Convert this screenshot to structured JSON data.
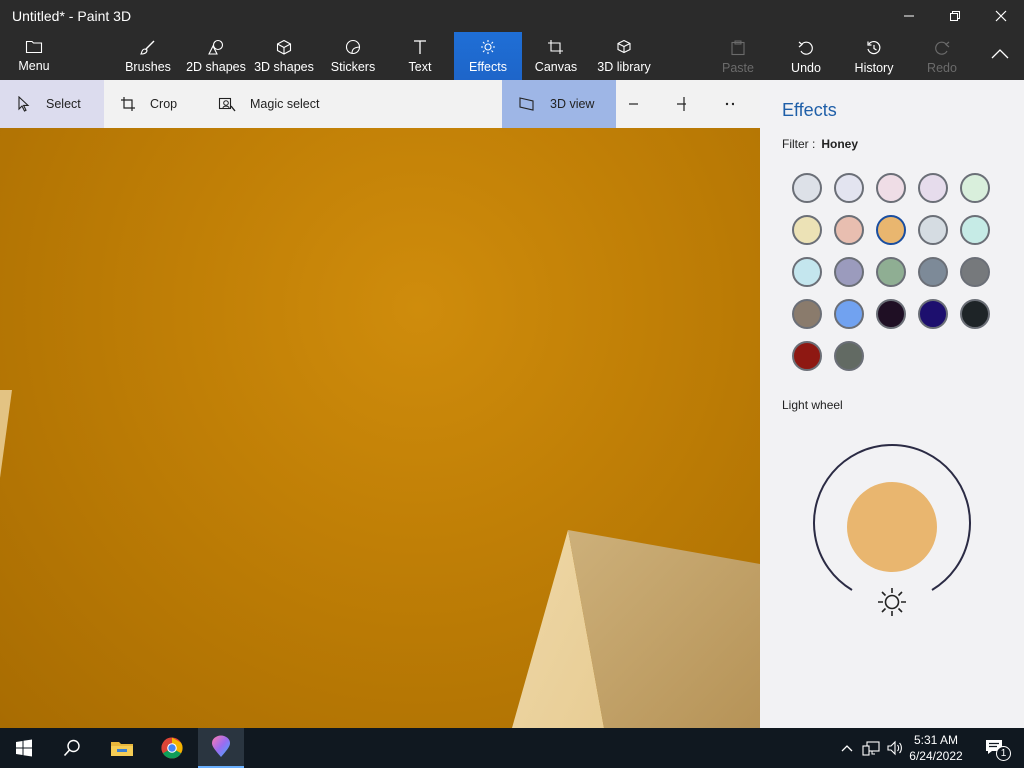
{
  "window": {
    "title": "Untitled* - Paint 3D"
  },
  "ribbon": {
    "menu": "Menu",
    "tools": [
      {
        "label": "Brushes",
        "icon": "brush-icon"
      },
      {
        "label": "2D shapes",
        "icon": "2d-shapes-icon"
      },
      {
        "label": "3D shapes",
        "icon": "3d-shapes-icon"
      },
      {
        "label": "Stickers",
        "icon": "stickers-icon"
      },
      {
        "label": "Text",
        "icon": "text-icon"
      },
      {
        "label": "Effects",
        "icon": "effects-icon",
        "active": true
      },
      {
        "label": "Canvas",
        "icon": "canvas-icon"
      },
      {
        "label": "3D library",
        "icon": "3d-library-icon"
      }
    ],
    "paste": "Paste",
    "undo": "Undo",
    "history": "History",
    "redo": "Redo"
  },
  "toolbar": {
    "select": "Select",
    "crop": "Crop",
    "magic_select": "Magic select",
    "view3d": "3D view"
  },
  "panel": {
    "title": "Effects",
    "filter_label": "Filter :",
    "filter_value": "Honey",
    "swatches": [
      "#dde1e8",
      "#e3e4f0",
      "#efdde6",
      "#e6dcec",
      "#d9efdc",
      "#ece2b6",
      "#e8beb0",
      "#e9b66f",
      "#d5dce2",
      "#c6ebe6",
      "#c4e6ee",
      "#9b9bbd",
      "#8fae93",
      "#7d8a98",
      "#76797c",
      "#8a7b6c",
      "#71a2f0",
      "#1f0f24",
      "#1d0f6e",
      "#1e2427",
      "#8e1812",
      "#626a63"
    ],
    "selected_swatch": 7,
    "light_wheel_label": "Light wheel",
    "light_color": "#e9b66f"
  },
  "colors": {
    "accent": "#1f6fd6",
    "canvas": "#c07f06"
  },
  "taskbar": {
    "time": "5:31 AM",
    "date": "6/24/2022",
    "notification_count": "1"
  }
}
